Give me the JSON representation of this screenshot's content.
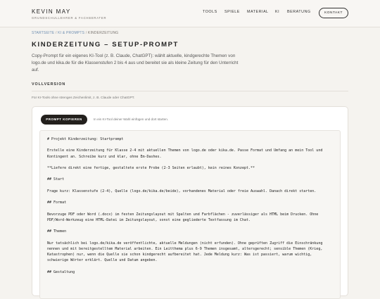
{
  "header": {
    "brand_name": "KEVIN MAY",
    "brand_sub": "GRUNDSCHULLEHRER & FACHBERATER",
    "nav": [
      "TOOLS",
      "SPIELE",
      "MATERIAL",
      "KI",
      "BERATUNG"
    ],
    "contact_label": "KONTAKT"
  },
  "breadcrumb": {
    "home": "STARTSEITE",
    "sep": " / ",
    "section": "KI & PROMPTS",
    "current": "KINDERZEITUNG"
  },
  "page": {
    "title": "KINDERZEITUNG – SETUP-PROMPT",
    "intro": "Copy-Prompt für ein eigenes KI-Tool (z. B. Claude, ChatGPT): wählt aktuelle, kindgerechte Themen von logo.de und kika.de für die Klassenstufen 2 bis 4 aus und bereitet sie als kleine Zeitung für den Unterricht auf."
  },
  "section": {
    "title": "VOLLVERSION",
    "note": "Für KI-Tools ohne strenges Zeichenlimit, z. B. Claude oder ChatGPT."
  },
  "card": {
    "copy_label": "PROMPT KOPIEREN",
    "copy_hint": "In ein KI-Tool deiner Wahl einfügen und dort starten.",
    "prompt_paragraphs": [
      "# Projekt Kinderzeitung: Startprompt",
      "Erstelle eine Kinderzeitung für Klasse 2-4 mit aktuellen Themen von logo.de oder kika.de. Passe Format und Umfang an mein Tool und Kontingent an. Schreibe kurz und klar, ohne Em-Dashes.",
      "**Liefere direkt eine fertige, gestaltete erste Probe (2-3 Seiten erlaubt), kein reines Konzept.**",
      "## Start",
      "Frage kurz: Klassenstufe (2-4), Quelle (logo.de/kika.de/beide), vorhandenes Material oder freie Auswahl. Danach direkt starten.",
      "## Format",
      "Bevorzuge PDF oder Word (.docx) im festen Zeitungslayout mit Spalten und Farbflächen - zuverlässiger als HTML beim Drucken. Ohne PDF/Word-Werkzeug eine HTML-Datei im Zeitungslayout, sonst eine gegliederte Textfassung im Chat.",
      "## Themen",
      "Nur tatsächlich bei logo.de/kika.de veröffentlichte, aktuelle Meldungen (nicht erfunden). Ohne geprüften Zugriff die Einschränkung nennen und mit bereitgestelltem Material arbeiten. Ein Leitthema plus 6-9 Themen insgesamt, altersgerecht; sensible Themen (Krieg, Katastrophen) nur, wenn die Quelle sie schon kindgerecht aufbereitet hat. Jede Meldung kurz: Was ist passiert, warum wichtig, schwierige Wörter erklärt. Quelle und Datum angeben.",
      "## Gestaltung"
    ]
  }
}
